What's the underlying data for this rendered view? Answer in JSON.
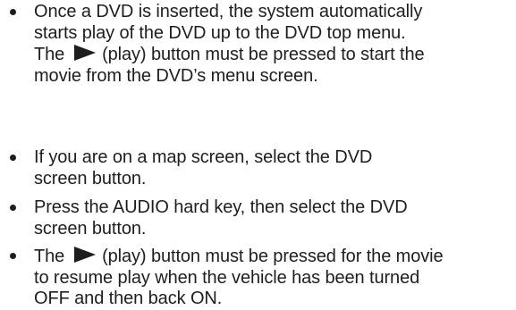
{
  "bullets": [
    {
      "lines": [
        "Once a DVD is inserted, the system automatically",
        "starts play of the DVD up to the DVD top menu.",
        {
          "before": "The ",
          "icon": "play-icon",
          "after": " (play) button must be pressed to start the"
        },
        "movie from the DVD’s menu screen."
      ]
    },
    {
      "lines": [
        "If you are on a map screen, select the DVD",
        "screen button."
      ]
    },
    {
      "lines": [
        "Press the AUDIO hard key, then select the DVD",
        "screen button."
      ]
    },
    {
      "lines": [
        {
          "before": "The ",
          "icon": "play-icon",
          "after": " (play) button must be pressed for the movie"
        },
        "to resume play when the vehicle has been turned",
        "OFF and then back ON."
      ]
    }
  ],
  "colors": {
    "text": "#1e1e1e",
    "background": "#ffffff"
  }
}
